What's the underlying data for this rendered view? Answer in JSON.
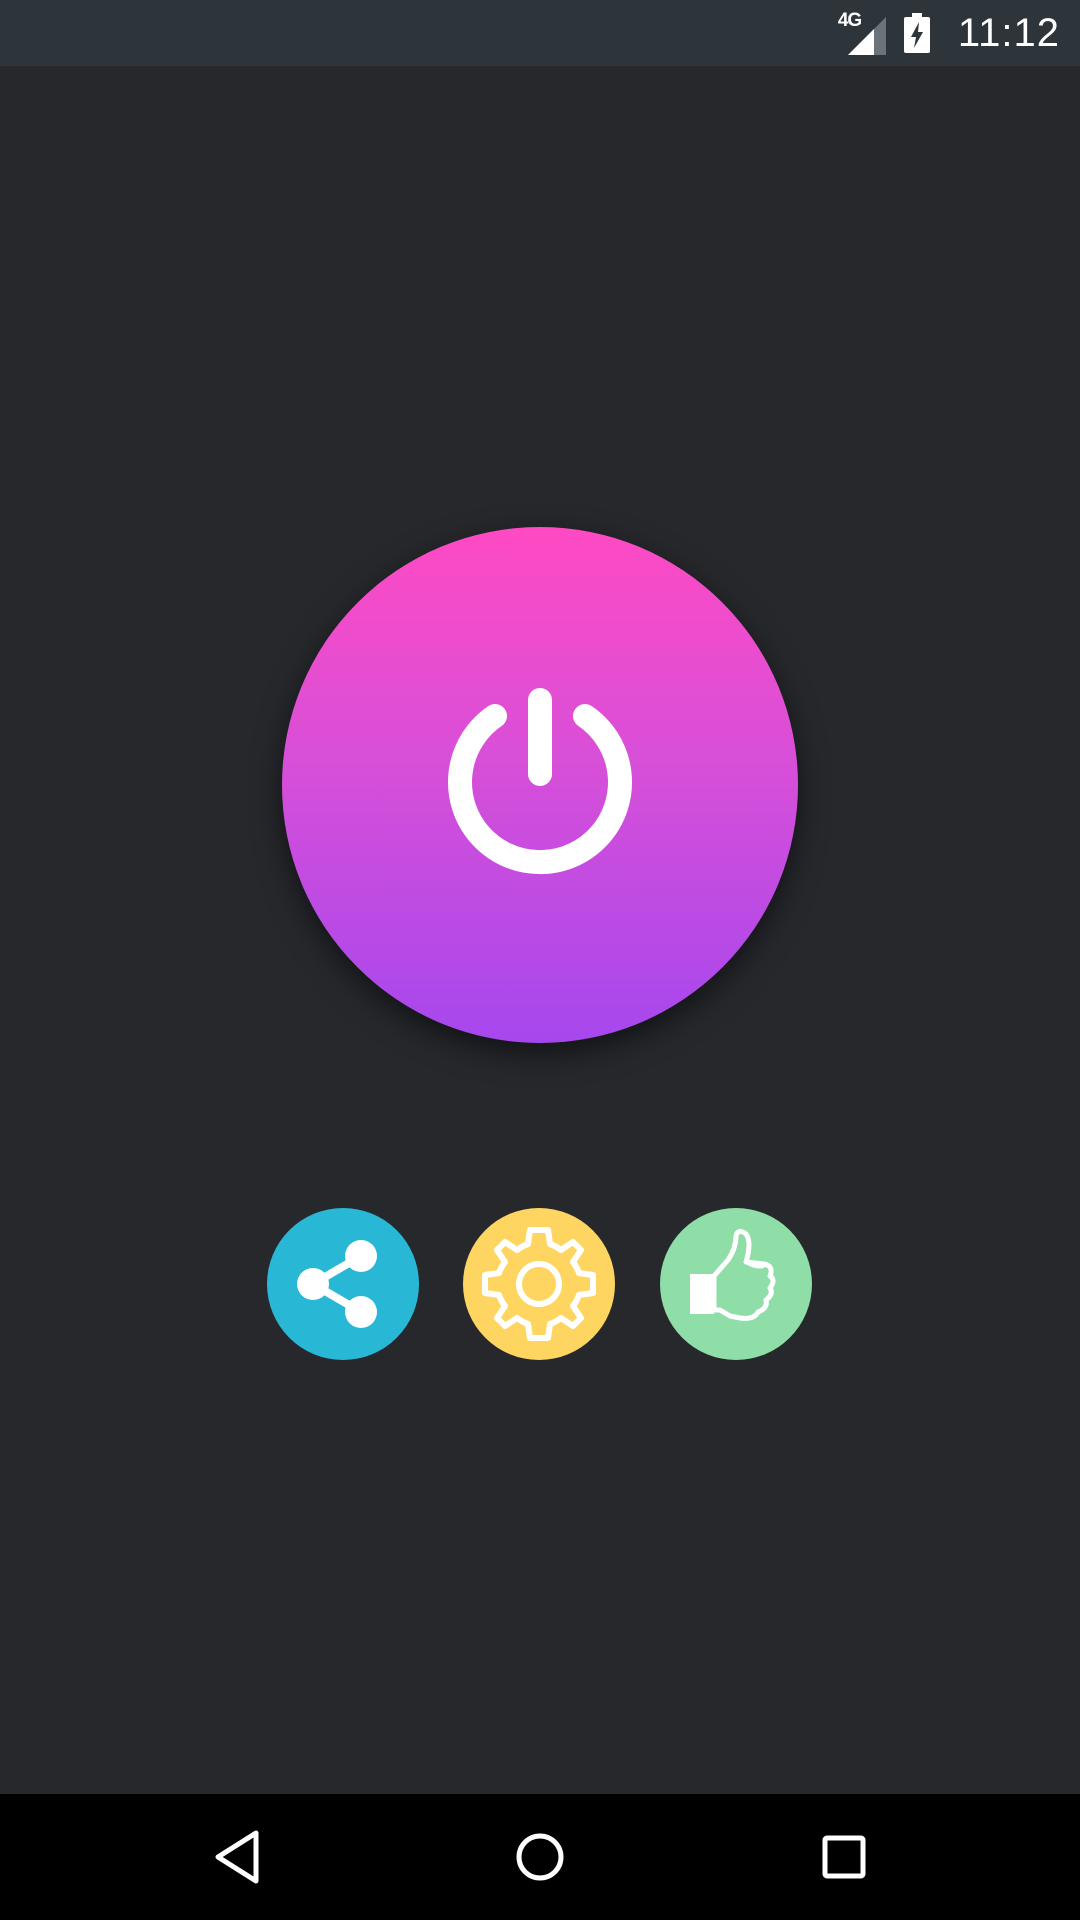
{
  "status_bar": {
    "network_type": "4G",
    "time": "11:12",
    "signal_icon": "signal-strength-icon",
    "battery_icon": "battery-charging-icon"
  },
  "power_button": {
    "icon": "power-icon",
    "gradient_top": "#ff4ac3",
    "gradient_bottom": "#a647ee"
  },
  "actions": [
    {
      "id": "share",
      "icon": "share-icon",
      "color": "#28b8d6"
    },
    {
      "id": "settings",
      "icon": "gear-icon",
      "color": "#ffd562"
    },
    {
      "id": "like",
      "icon": "thumbs-up-icon",
      "color": "#8fdea8"
    }
  ],
  "nav_bar": {
    "back_icon": "back-triangle-icon",
    "home_icon": "home-circle-icon",
    "recents_icon": "recents-square-icon"
  },
  "colors": {
    "background": "#26282c",
    "status_bar": "#2d353b",
    "nav_bar": "#000000",
    "icon_white": "#ffffff"
  }
}
